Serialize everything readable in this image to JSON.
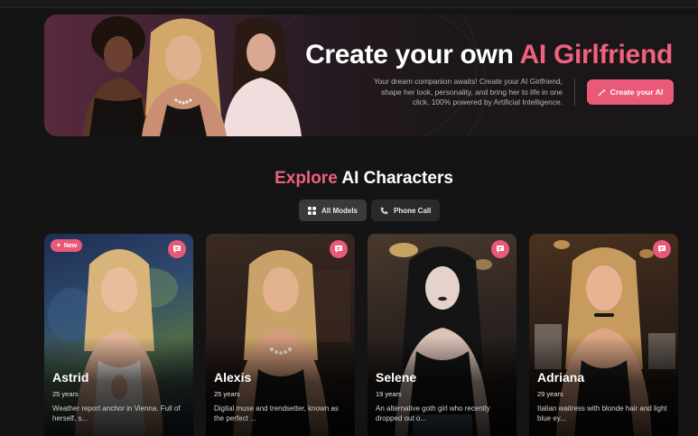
{
  "hero": {
    "title_prefix": "Create your own ",
    "title_accent": "AI Girlfriend",
    "description": "Your dream companion awaits! Create your AI Girlfriend, shape her look, personality, and bring her to life in one click. 100% powered by Artificial Intelligence.",
    "cta_label": "Create your AI"
  },
  "explore": {
    "title_accent": "Explore",
    "title_rest": " AI Characters"
  },
  "filters": [
    {
      "label": "All Models",
      "icon": "grid-icon",
      "active": true
    },
    {
      "label": "Phone Call",
      "icon": "phone-icon",
      "active": false
    }
  ],
  "cards": [
    {
      "name": "Astrid",
      "age": "25 years",
      "description": "Weather report anchor in Vienna. Full of herself, s...",
      "badge": "New",
      "dress": "#f2ede6",
      "hair": "#d8b47a",
      "scene": "weather"
    },
    {
      "name": "Alexis",
      "age": "25 years",
      "description": "Digital muse and trendsetter, known as the perfect ...",
      "badge": "",
      "dress": "#1b1716",
      "hair": "#c9a26a",
      "scene": "dark"
    },
    {
      "name": "Selene",
      "age": "19 years",
      "description": "An alternative goth girl who recently dropped out o...",
      "badge": "",
      "dress": "#151515",
      "hair": "#141414",
      "scene": "cafe"
    },
    {
      "name": "Adriana",
      "age": "29 years",
      "description": "Italian waitress with blonde hair and light blue ey...",
      "badge": "",
      "dress": "#1a1a1a",
      "hair": "#c79a5e",
      "scene": "restaurant"
    }
  ],
  "colors": {
    "accent": "#ea5a78",
    "background": "#141414"
  }
}
